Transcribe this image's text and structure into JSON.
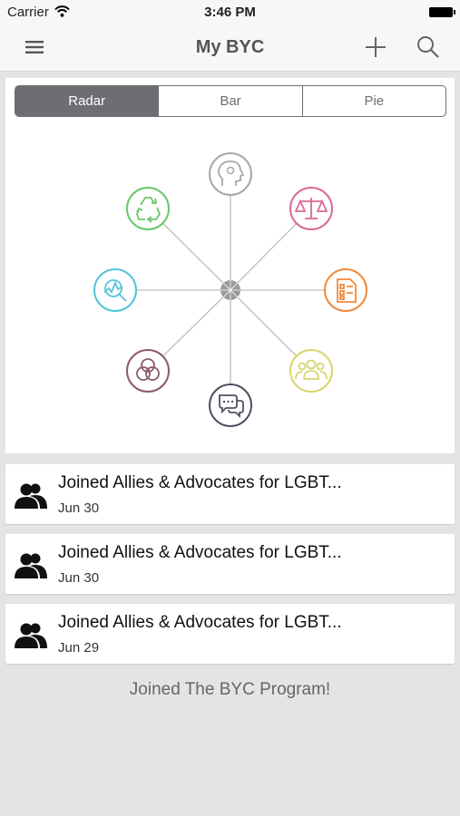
{
  "status_bar": {
    "carrier": "Carrier",
    "time": "3:46 PM"
  },
  "nav": {
    "title": "My BYC"
  },
  "chart_tabs": [
    {
      "label": "Radar",
      "active": true
    },
    {
      "label": "Bar",
      "active": false
    },
    {
      "label": "Pie",
      "active": false
    }
  ],
  "radar_nodes": [
    {
      "icon": "brain-head-icon",
      "color": "#a8a8a8"
    },
    {
      "icon": "scales-icon",
      "color": "#d96a98"
    },
    {
      "icon": "checklist-document-icon",
      "color": "#f08a3c"
    },
    {
      "icon": "group-icon",
      "color": "#d8d66e"
    },
    {
      "icon": "chat-bubbles-icon",
      "color": "#4d5360"
    },
    {
      "icon": "venn-circles-icon",
      "color": "#8b5a6c"
    },
    {
      "icon": "magnifier-chart-icon",
      "color": "#55c3dc"
    },
    {
      "icon": "recycle-icon",
      "color": "#68c96b"
    }
  ],
  "activities": [
    {
      "title": "Joined Allies & Advocates for LGBT...",
      "date": "Jun 30"
    },
    {
      "title": "Joined Allies & Advocates for LGBT...",
      "date": "Jun 30"
    },
    {
      "title": "Joined Allies & Advocates for LGBT...",
      "date": "Jun 29"
    }
  ],
  "footer_message": "Joined The BYC Program!"
}
